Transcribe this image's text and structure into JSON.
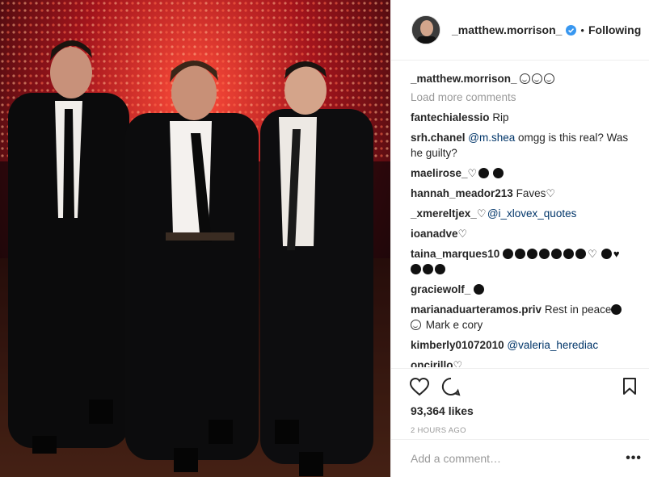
{
  "header": {
    "username": "_matthew.morrison_",
    "separator": "•",
    "follow_status": "Following"
  },
  "caption": {
    "username": "_matthew.morrison_",
    "emojis": [
      "smiling-face-icon",
      "smiling-face-icon",
      "smiling-face-icon"
    ]
  },
  "load_more": "Load more comments",
  "comments": [
    {
      "user": "fantechialessio",
      "pre": "",
      "mention": "",
      "text": "Rip"
    },
    {
      "user": "srh.chanel",
      "pre": "",
      "mention": "@m.shea",
      "text": "omgg is this real? Was he guilty?"
    },
    {
      "user": "maelirose_",
      "pre": "",
      "mention": "",
      "text": ""
    },
    {
      "user": "hannah_meador213",
      "pre": "",
      "mention": "",
      "text": "Faves"
    },
    {
      "user": "_xmereltjex_",
      "pre": "",
      "mention": "@i_xlovex_quotes",
      "text": ""
    },
    {
      "user": "ioanadve",
      "pre": "",
      "mention": "",
      "text": ""
    },
    {
      "user": "taina_marques10",
      "pre": "",
      "mention": "",
      "text": ""
    },
    {
      "user": "graciewolf_",
      "pre": "",
      "mention": "",
      "text": ""
    },
    {
      "user": "marianaduarteramos.priv",
      "pre": "",
      "mention": "",
      "text": "Rest in peace"
    },
    {
      "user": "kimberly01072010",
      "pre": "",
      "mention": "@valeria_herediac",
      "text": ""
    },
    {
      "user": "oncirillo",
      "pre": "",
      "mention": "",
      "text": ""
    }
  ],
  "mariana_extra": "Mark e cory",
  "likes": "93,364 likes",
  "time": "2 HOURS AGO",
  "add_comment_placeholder": "Add a comment…",
  "more_label": "•••",
  "colors": {
    "mention": "#003569",
    "muted": "#999999",
    "verified": "#3897f0"
  }
}
